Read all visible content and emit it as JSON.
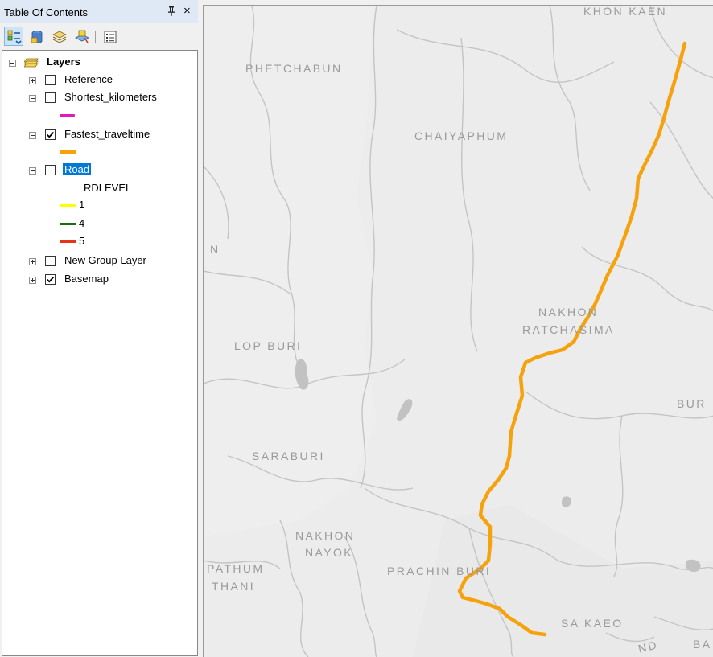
{
  "toc": {
    "title": "Table Of Contents",
    "pin_glyph": "⬇",
    "close_glyph": "×",
    "toolbar": [
      {
        "name": "list-by-drawing-order-icon",
        "active": true
      },
      {
        "name": "list-by-source-icon",
        "active": false
      },
      {
        "name": "list-by-visibility-icon",
        "active": false
      },
      {
        "name": "list-by-selection-icon",
        "active": false
      },
      {
        "name": "options-icon",
        "active": false
      }
    ],
    "layers_root": "Layers",
    "layers": {
      "reference": {
        "label": "Reference",
        "checked": false,
        "expanded": false
      },
      "shortest": {
        "label": "Shortest_kilometers",
        "checked": false,
        "expanded": true,
        "color": "#e619b8"
      },
      "fastest": {
        "label": "Fastest_traveltime",
        "checked": true,
        "expanded": true,
        "color": "#f5a20c"
      },
      "road": {
        "label": "Road",
        "checked": false,
        "expanded": true,
        "field": "RDLEVEL",
        "classes": [
          {
            "label": "1",
            "color": "#ffff00"
          },
          {
            "label": "4",
            "color": "#1a6b12"
          },
          {
            "label": "5",
            "color": "#e8321e"
          }
        ]
      },
      "group": {
        "label": "New Group Layer",
        "checked": false,
        "expanded": false
      },
      "basemap": {
        "label": "Basemap",
        "checked": true,
        "expanded": false
      }
    }
  },
  "map": {
    "route_color": "#f5a20c",
    "labels": {
      "khon_kaen": "KHON KAEN",
      "phetchabun": "PHETCHABUN",
      "chaiyaphum": "CHAIYAPHUM",
      "n_edge": "N",
      "nakhon_ratchasima_1": "NAKHON",
      "nakhon_ratchasima_2": "RATCHASIMA",
      "lop_buri": "LOP BURI",
      "bur_edge": "BUR",
      "saraburi": "SARABURI",
      "nakhon_nayok_1": "NAKHON",
      "nakhon_nayok_2": "NAYOK",
      "pathum_thani_1": "PATHUM",
      "pathum_thani_2": "THANI",
      "prachin_buri": "PRACHIN BURI",
      "sa_kaeo": "SA KAEO",
      "nd_edge": "ND",
      "ba_edge": "BA"
    }
  }
}
